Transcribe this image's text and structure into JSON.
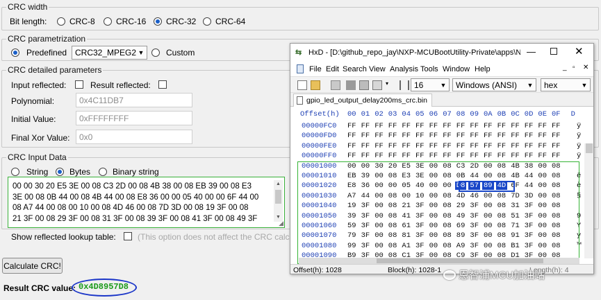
{
  "crc_width": {
    "title": "CRC width",
    "label": "Bit length:",
    "options": [
      "CRC-8",
      "CRC-16",
      "CRC-32",
      "CRC-64"
    ],
    "selected": "CRC-32"
  },
  "parametrization": {
    "title": "CRC parametrization",
    "predefined_label": "Predefined",
    "predefined_value": "CRC32_MPEG2",
    "custom_label": "Custom"
  },
  "detailed": {
    "title": "CRC detailed parameters",
    "input_reflected_label": "Input reflected:",
    "result_reflected_label": "Result reflected:",
    "polynomial_label": "Polynomial:",
    "polynomial_value": "0x4C11DB7",
    "initial_label": "Initial Value:",
    "initial_value": "0xFFFFFFFF",
    "final_label": "Final Xor Value:",
    "final_value": "0x0"
  },
  "input_data": {
    "title": "CRC Input Data",
    "options": [
      "String",
      "Bytes",
      "Binary string"
    ],
    "selected": "Bytes",
    "lines": [
      "00 00 30 20 E5 3E 00 08 C3 2D 00 08 4B 38 00 08 EB 39 00 08 E3",
      "3E 00 08 0B 44 00 08 4B 44 00 08 E8 36 00 00 05 40 00 00 6F 44 00",
      "08 A7 44 00 08 00 10 00 08 4D 46 00 08 7D 3D 00 08 19 3F 00 08",
      "21 3F 00 08 29 3F 00 08 31 3F 00 08 39 3F 00 08 41 3F 00 08 49 3F"
    ]
  },
  "lookup": {
    "label": "Show reflected lookup table:",
    "note": "(This option does not affect the CRC calcu"
  },
  "calculate_label": "Calculate CRC!",
  "result": {
    "label": "Result CRC value:",
    "value": "0x4D8957D8"
  },
  "hxd": {
    "title": "HxD - [D:\\github_repo_jay\\NXP-MCUBootUtility-Private\\apps\\N...",
    "menu": [
      "File",
      "Edit",
      "Search",
      "View",
      "Analysis",
      "Tools",
      "Window",
      "Help"
    ],
    "columns_value": "16",
    "charset_value": "Windows (ANSI)",
    "format_value": "hex",
    "tab_label": "gpio_led_output_delay200ms_crc.bin",
    "header_offset": "Offset(h)",
    "header_cols": [
      "00",
      "01",
      "02",
      "03",
      "04",
      "05",
      "06",
      "07",
      "08",
      "09",
      "0A",
      "0B",
      "0C",
      "0D",
      "0E",
      "0F",
      "D"
    ],
    "rows": [
      {
        "offset": "00000FC0",
        "bytes": [
          "FF",
          "FF",
          "FF",
          "FF",
          "FF",
          "FF",
          "FF",
          "FF",
          "FF",
          "FF",
          "FF",
          "FF",
          "FF",
          "FF",
          "FF",
          "FF"
        ],
        "ch": "ÿ"
      },
      {
        "offset": "00000FD0",
        "bytes": [
          "FF",
          "FF",
          "FF",
          "FF",
          "FF",
          "FF",
          "FF",
          "FF",
          "FF",
          "FF",
          "FF",
          "FF",
          "FF",
          "FF",
          "FF",
          "FF"
        ],
        "ch": "ÿ"
      },
      {
        "offset": "00000FE0",
        "bytes": [
          "FF",
          "FF",
          "FF",
          "FF",
          "FF",
          "FF",
          "FF",
          "FF",
          "FF",
          "FF",
          "FF",
          "FF",
          "FF",
          "FF",
          "FF",
          "FF"
        ],
        "ch": "ÿ"
      },
      {
        "offset": "00000FF0",
        "bytes": [
          "FF",
          "FF",
          "FF",
          "FF",
          "FF",
          "FF",
          "FF",
          "FF",
          "FF",
          "FF",
          "FF",
          "FF",
          "FF",
          "FF",
          "FF",
          "FF"
        ],
        "ch": "ÿ"
      },
      {
        "offset": "00001000",
        "bytes": [
          "00",
          "00",
          "30",
          "20",
          "E5",
          "3E",
          "00",
          "08",
          "C3",
          "2D",
          "00",
          "08",
          "4B",
          "38",
          "00",
          "08"
        ],
        "ch": ""
      },
      {
        "offset": "00001010",
        "bytes": [
          "EB",
          "39",
          "00",
          "08",
          "E3",
          "3E",
          "00",
          "08",
          "0B",
          "44",
          "00",
          "08",
          "4B",
          "44",
          "00",
          "08"
        ],
        "ch": "ë"
      },
      {
        "offset": "00001020",
        "bytes": [
          "E8",
          "36",
          "00",
          "00",
          "05",
          "40",
          "00",
          "00",
          "D8",
          "57",
          "89",
          "4D",
          "6F",
          "44",
          "00",
          "08"
        ],
        "ch": "è"
      },
      {
        "offset": "00001030",
        "bytes": [
          "A7",
          "44",
          "00",
          "08",
          "00",
          "10",
          "00",
          "08",
          "4D",
          "46",
          "00",
          "08",
          "7D",
          "3D",
          "00",
          "08"
        ],
        "ch": "§"
      },
      {
        "offset": "00001040",
        "bytes": [
          "19",
          "3F",
          "00",
          "08",
          "21",
          "3F",
          "00",
          "08",
          "29",
          "3F",
          "00",
          "08",
          "31",
          "3F",
          "00",
          "08"
        ],
        "ch": ""
      },
      {
        "offset": "00001050",
        "bytes": [
          "39",
          "3F",
          "00",
          "08",
          "41",
          "3F",
          "00",
          "08",
          "49",
          "3F",
          "00",
          "08",
          "51",
          "3F",
          "00",
          "08"
        ],
        "ch": "9"
      },
      {
        "offset": "00001060",
        "bytes": [
          "59",
          "3F",
          "00",
          "08",
          "61",
          "3F",
          "00",
          "08",
          "69",
          "3F",
          "00",
          "08",
          "71",
          "3F",
          "00",
          "08"
        ],
        "ch": "Y"
      },
      {
        "offset": "00001070",
        "bytes": [
          "79",
          "3F",
          "00",
          "08",
          "81",
          "3F",
          "00",
          "08",
          "89",
          "3F",
          "00",
          "08",
          "91",
          "3F",
          "00",
          "08"
        ],
        "ch": "y"
      },
      {
        "offset": "00001080",
        "bytes": [
          "99",
          "3F",
          "00",
          "08",
          "A1",
          "3F",
          "00",
          "08",
          "A9",
          "3F",
          "00",
          "08",
          "B1",
          "3F",
          "00",
          "08"
        ],
        "ch": "™"
      },
      {
        "offset": "00001090",
        "bytes": [
          "B9",
          "3F",
          "00",
          "08",
          "C1",
          "3F",
          "00",
          "08",
          "C9",
          "3F",
          "00",
          "08",
          "D1",
          "3F",
          "00",
          "08"
        ],
        "ch": ""
      }
    ],
    "highlight_text": "D8 57 89 4D",
    "status_offset": "Offset(h): 1028",
    "status_block": "Block(h): 1028-1",
    "status_length": "Length(h): 4"
  },
  "watermark": "恩智浦MCU加油站",
  "colors": {
    "accent": "#1a5fc8",
    "result_green": "#1a9a1a",
    "highlight_blue": "#1846c8",
    "select_green": "#35b335"
  }
}
